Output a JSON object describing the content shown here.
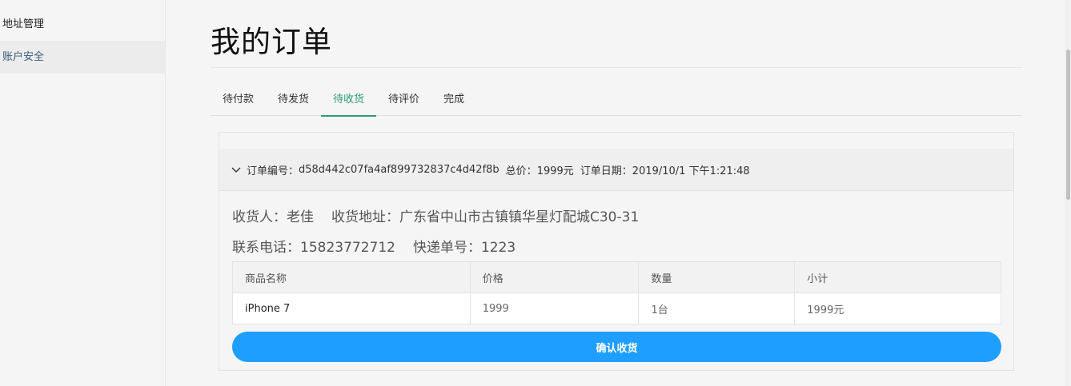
{
  "sidebar": {
    "items": [
      {
        "label": "地址管理",
        "active": false
      },
      {
        "label": "账户安全",
        "active": true
      }
    ]
  },
  "page": {
    "title": "我的订单"
  },
  "tabs": [
    {
      "label": "待付款",
      "active": false
    },
    {
      "label": "待发货",
      "active": false
    },
    {
      "label": "待收货",
      "active": true
    },
    {
      "label": "待评价",
      "active": false
    },
    {
      "label": "完成",
      "active": false
    }
  ],
  "order": {
    "number_label": "订单编号：",
    "number": "d58d442c07fa4af899732837c4d42f8b",
    "total_label": "总价：",
    "total": "1999元",
    "date_label": "订单日期：",
    "date": "2019/10/1 下午1:21:48",
    "receiver_label": "收货人：",
    "receiver": "老佳",
    "address_label": "收货地址：",
    "address": "广东省中山市古镇镇华星灯配城C30-31",
    "phone_label": "联系电话：",
    "phone": "15823772712",
    "tracking_label": "快递单号：",
    "tracking": "1223",
    "table": {
      "headers": [
        "商品名称",
        "价格",
        "数量",
        "小计"
      ],
      "rows": [
        [
          "iPhone 7",
          "1999",
          "1台",
          "1999元"
        ]
      ]
    },
    "confirm_label": "确认收货"
  },
  "colors": {
    "accent_green": "#2a9d6f",
    "button_blue": "#1e9fff"
  }
}
